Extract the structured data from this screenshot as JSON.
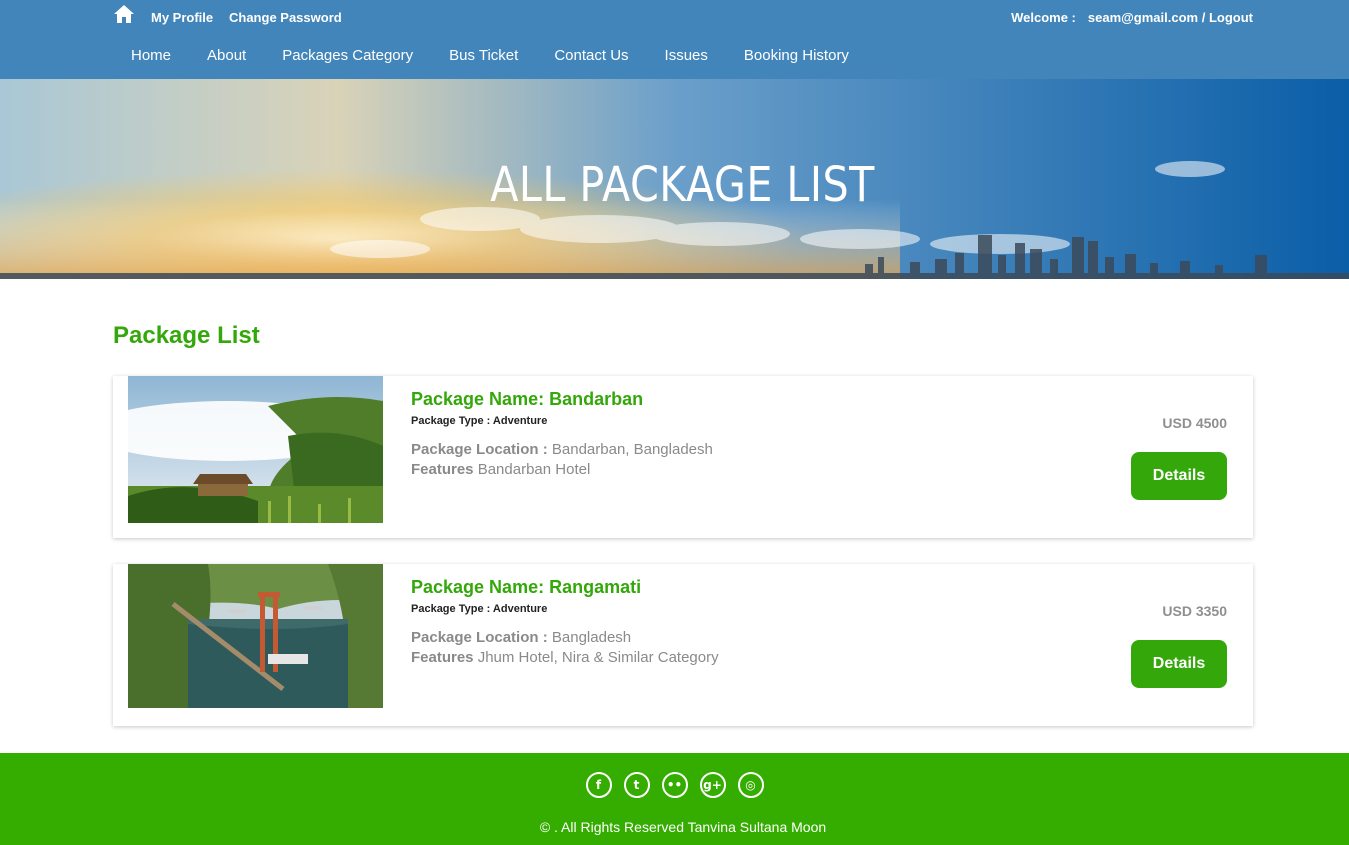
{
  "topbar": {
    "my_profile": "My Profile",
    "change_password": "Change Password",
    "welcome_label": "Welcome :",
    "user_email": "seam@gmail.com",
    "separator": " / ",
    "logout": "Logout"
  },
  "nav": {
    "items": [
      {
        "label": "Home"
      },
      {
        "label": "About"
      },
      {
        "label": "Packages Category"
      },
      {
        "label": "Bus Ticket"
      },
      {
        "label": "Contact Us"
      },
      {
        "label": "Issues"
      },
      {
        "label": "Booking History"
      }
    ]
  },
  "banner": {
    "title": "ALL PACKAGE LIST"
  },
  "main": {
    "section_title": "Package List",
    "packages": [
      {
        "name": "Package Name: Bandarban",
        "type": "Package Type : Adventure",
        "location_label": "Package Location :",
        "location": "Bandarban, Bangladesh",
        "features_label": "Features",
        "features": "Bandarban Hotel",
        "price": "USD 4500",
        "details_label": "Details"
      },
      {
        "name": "Package Name: Rangamati",
        "type": "Package Type : Adventure",
        "location_label": "Package Location :",
        "location": "Bangladesh",
        "features_label": "Features",
        "features": "Jhum Hotel, Nira & Similar Category",
        "price": "USD 3350",
        "details_label": "Details"
      }
    ]
  },
  "footer": {
    "social": [
      {
        "icon": "facebook-icon",
        "glyph": "f"
      },
      {
        "icon": "twitter-icon",
        "glyph": "t"
      },
      {
        "icon": "flickr-icon",
        "glyph": "••"
      },
      {
        "icon": "google-plus-icon",
        "glyph": "g+"
      },
      {
        "icon": "dribbble-icon",
        "glyph": "◎"
      }
    ],
    "copyright": "© . All Rights Reserved Tanvina Sultana Moon"
  },
  "colors": {
    "header": "#4285ba",
    "accent_green": "#34a80a",
    "footer_green": "#34ad00"
  }
}
